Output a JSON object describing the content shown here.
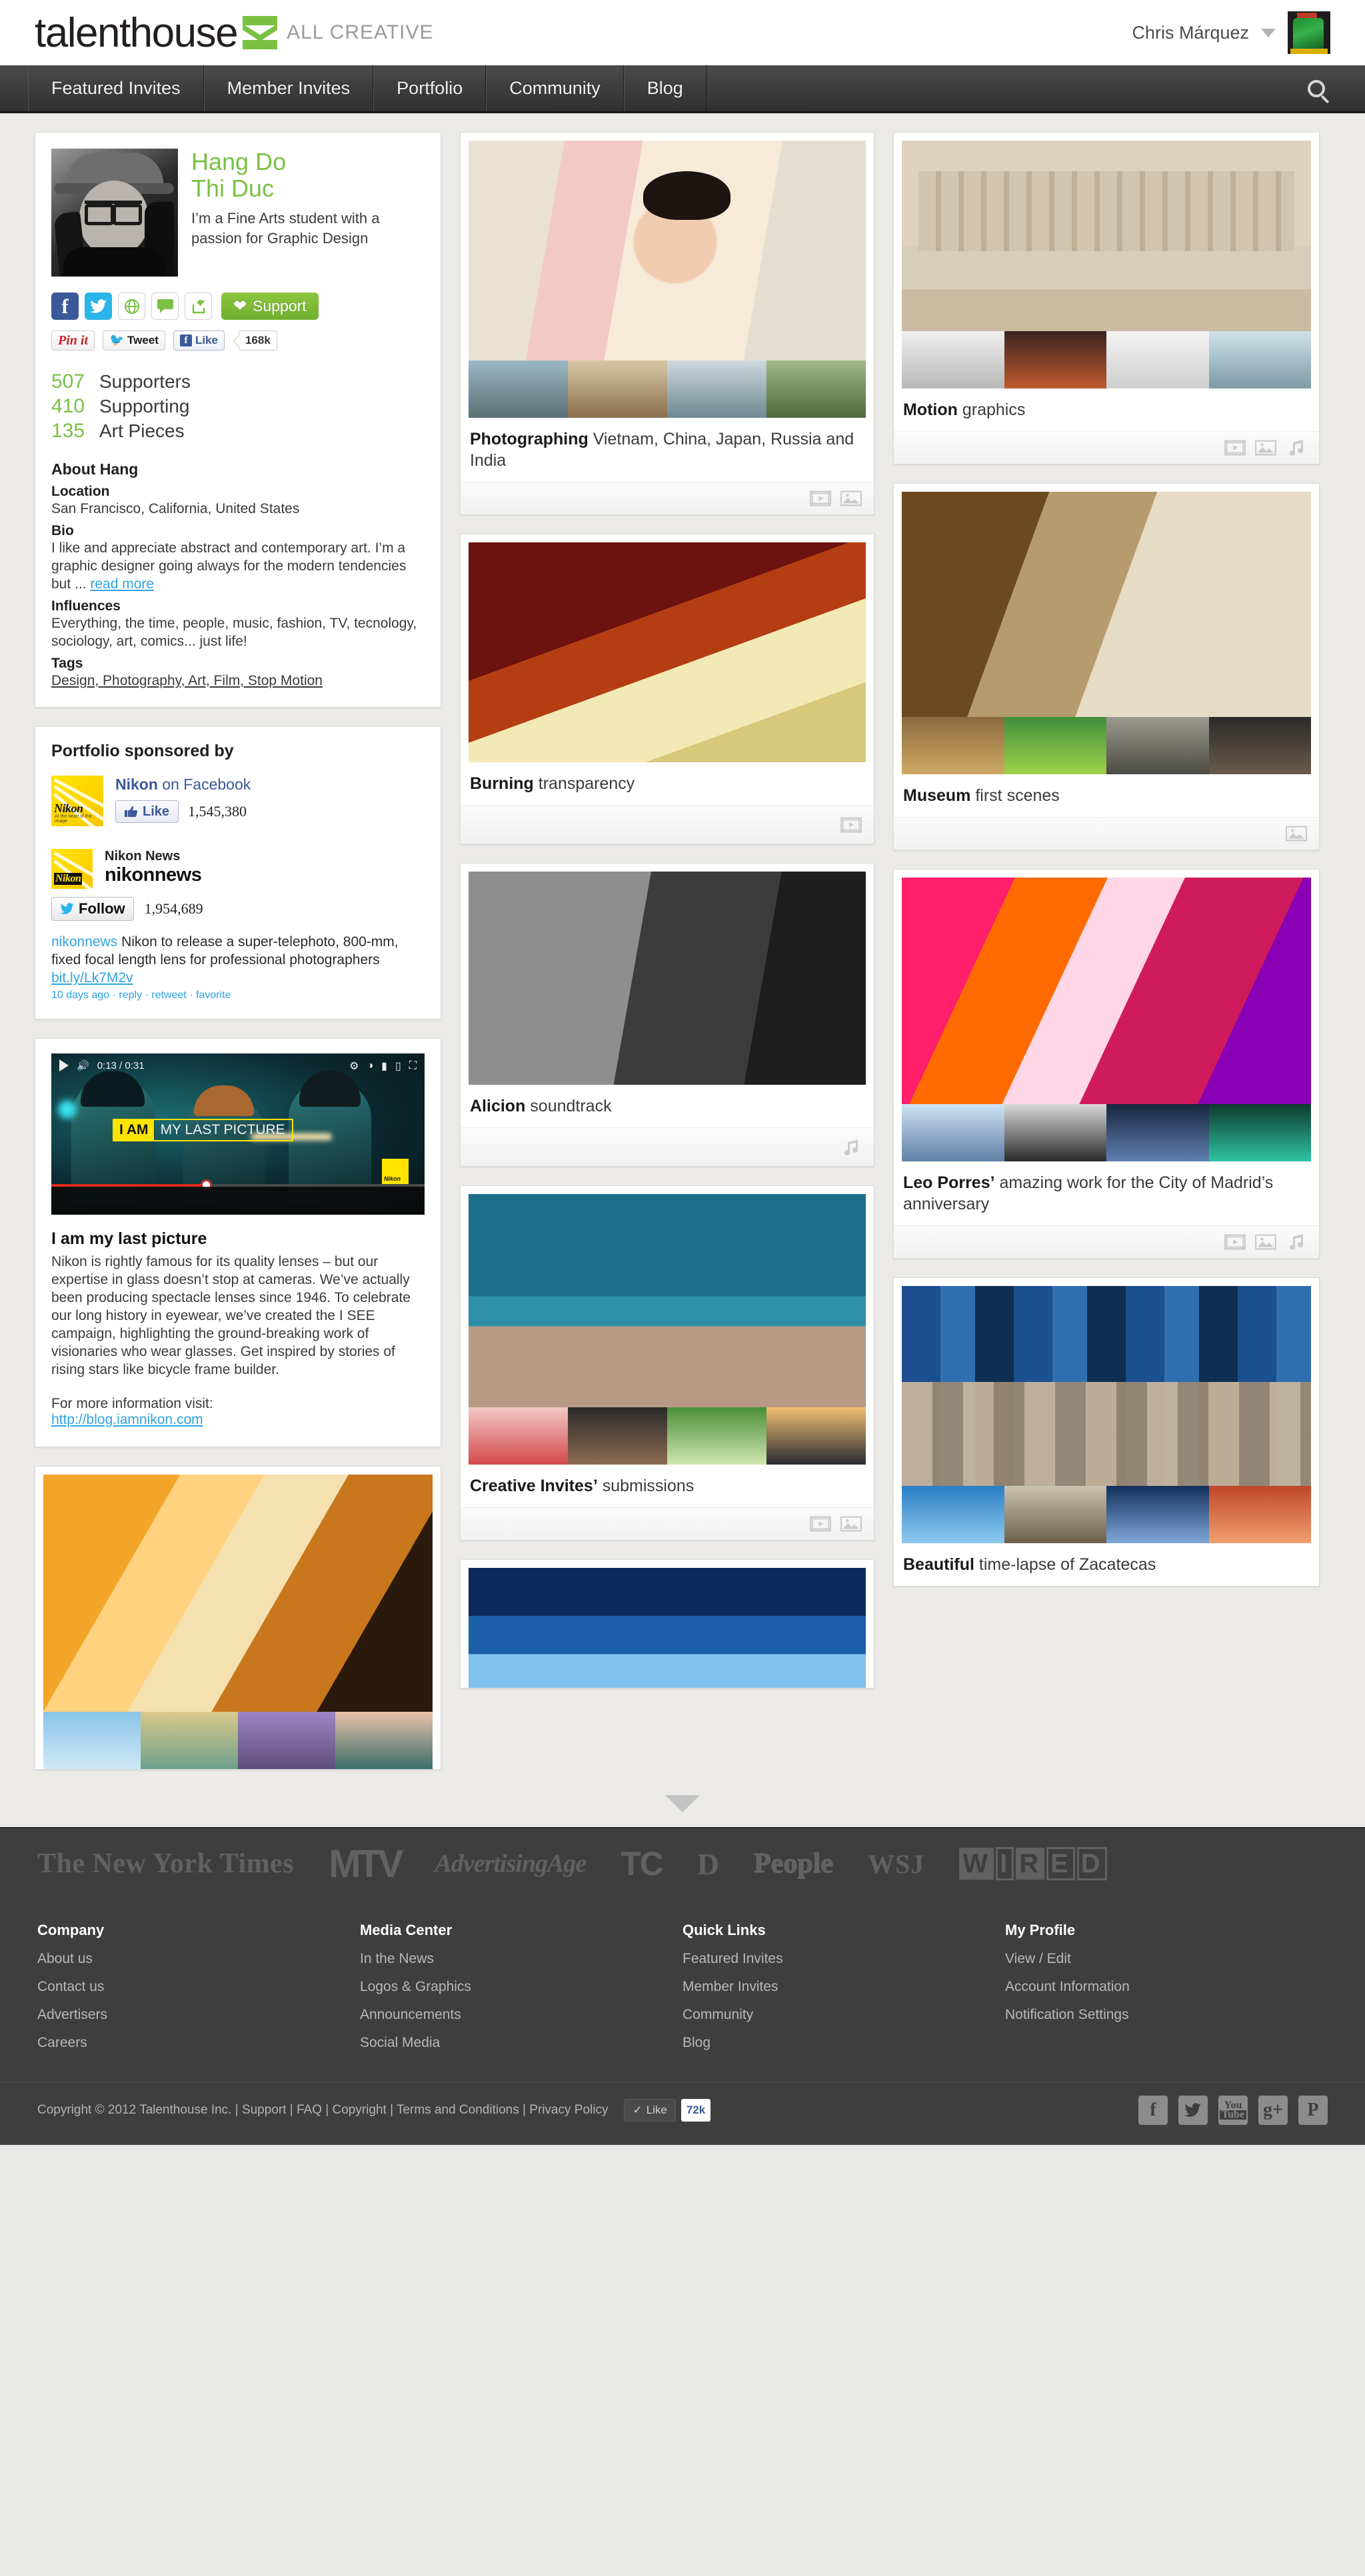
{
  "header": {
    "brand_word": "talenthouse",
    "brand_tagline": "ALL CREATIVE",
    "user_name": "Chris Márquez",
    "logo_icon": "talenthouse-chevron-logo",
    "caret_icon": "chevron-down-icon",
    "avatar_icon": "user-avatar"
  },
  "nav": {
    "items": [
      {
        "label": "Featured Invites"
      },
      {
        "label": "Member Invites"
      },
      {
        "label": "Portfolio"
      },
      {
        "label": "Community"
      },
      {
        "label": "Blog"
      }
    ],
    "search_icon": "search-icon"
  },
  "profile": {
    "name_line1": "Hang Do",
    "name_line2": "Thi Duc",
    "tagline": "I’m a Fine Arts student with a passion for Graphic Design",
    "social_icons": [
      "facebook-icon",
      "twitter-icon",
      "globe-icon",
      "comment-icon",
      "share-icon"
    ],
    "support_label": "Support",
    "support_icon": "heart-icon",
    "share_buttons": {
      "pinit_label": "Pin it",
      "tweet_label": "Tweet",
      "like_label": "Like",
      "like_count": "168k"
    },
    "stats": [
      {
        "value": "507",
        "label": "Supporters"
      },
      {
        "value": "410",
        "label": "Supporting"
      },
      {
        "value": "135",
        "label": "Art Pieces"
      }
    ],
    "about_heading": "About Hang",
    "location_label": "Location",
    "location_value": "San Francisco, California, United States",
    "bio_label": "Bio",
    "bio_value": "I like and appreciate abstract and contemporary art. I’m a graphic designer going always for the modern tendencies but ...",
    "read_more": "read more",
    "influences_label": "Influences",
    "influences_value": "Everything, the time, people, music, fashion, TV, tecnology, sociology, art, comics... just life!",
    "tags_label": "Tags",
    "tags_value": "Design, Photography, Art, Film, Stop Motion"
  },
  "sponsor": {
    "heading": "Portfolio sponsored by",
    "facebook": {
      "title_bold": "Nikon",
      "title_rest": " on Facebook",
      "like_label": "Like",
      "like_icon": "thumbs-up-icon",
      "count": "1,545,380"
    },
    "twitter": {
      "name": "Nikon News",
      "handle": "nikonnews",
      "follow_label": "Follow",
      "follow_icon": "twitter-bird-icon",
      "count": "1,954,689",
      "tweet_handle": "nikonnews",
      "tweet_text": " Nikon to release a super-telephoto, 800-mm, fixed focal length lens for professional photographers ",
      "tweet_link": "bit.ly/Lk7M2v",
      "tweet_meta": "10 days ago · reply · retweet · favorite"
    }
  },
  "sponsor_video": {
    "caption_highlight": "I AM",
    "caption_rest": "MY LAST PICTURE",
    "time": "0:13 / 0:31",
    "play_icon": "play-icon",
    "volume_icon": "volume-icon",
    "settings_icon": "gear-icon",
    "fullscreen_icon": "fullscreen-icon",
    "badge": "Nikon",
    "title": "I am my last picture",
    "body": "Nikon is rightly famous for its quality lenses – but our expertise in glass doesn’t stop at cameras. We’ve actually been producing spectacle lenses since 1946. To celebrate our long history in eyewear, we’ve created the I SEE campaign, highlighting the ground-breaking work of visionaries who wear glasses.  Get inspired by stories of rising stars like bicycle frame builder.",
    "more_info": "For more information visit:",
    "url": "http://blog.iamnikon.com"
  },
  "portfolio": {
    "middle_column": [
      {
        "title_bold": "Photographing",
        "title_rest": " Vietnam, China, Japan, Russia and India",
        "hero_class": "im-baby",
        "thumbs": [
          "t1",
          "t2",
          "t3",
          "t4"
        ],
        "icons": [
          "video-icon",
          "photo-icon"
        ]
      },
      {
        "title_bold": "Burning",
        "title_rest": " transparency",
        "hero_class": "im-burn",
        "thumbs": [],
        "icons": [
          "video-icon"
        ]
      },
      {
        "title_bold": "Alicion",
        "title_rest": " soundtrack",
        "hero_class": "im-alicia",
        "thumbs": [],
        "icons": [
          "music-icon"
        ]
      },
      {
        "title_bold": "Creative Invites’",
        "title_rest": " submissions",
        "hero_class": "im-water",
        "thumbs": [
          "t17",
          "t18",
          "t19",
          "t20"
        ],
        "icons": [
          "video-icon",
          "photo-icon"
        ]
      },
      {
        "title_bold": "",
        "title_rest": "",
        "hero_class": "im-blue",
        "thumbs": [],
        "icons": []
      }
    ],
    "right_column": [
      {
        "title_bold": "Motion",
        "title_rest": " graphics",
        "hero_class": "im-venice",
        "thumbs": [
          "t5",
          "t6",
          "t7",
          "t8"
        ],
        "icons": [
          "video-icon",
          "photo-icon",
          "music-icon"
        ]
      },
      {
        "title_bold": "Museum",
        "title_rest": " first scenes",
        "hero_class": "im-lion",
        "thumbs": [
          "t9",
          "t10",
          "t11",
          "t12"
        ],
        "icons": [
          "photo-icon"
        ]
      },
      {
        "title_bold": "Leo Porres’",
        "title_rest": " amazing work for the City of Madrid’s anniversary",
        "hero_class": "im-neon",
        "thumbs": [
          "t13",
          "t14",
          "t15",
          "t16"
        ],
        "icons": [
          "video-icon",
          "photo-icon",
          "music-icon"
        ]
      },
      {
        "title_bold": "Beautiful",
        "title_rest": " time-lapse of Zacatecas",
        "hero_class": "im-zac",
        "thumbs": [
          "t21",
          "t22",
          "t23",
          "t24"
        ],
        "icons": []
      }
    ],
    "left_column_extra": {
      "hero_class": "im-dance",
      "thumbs": [
        "t25",
        "t26",
        "t27",
        "t28"
      ]
    },
    "scroll_hint_icon": "chevron-down-icon"
  },
  "press_logos": [
    {
      "name": "The New York Times",
      "cls": "logo-nyt"
    },
    {
      "name": "MTV",
      "cls": "logo-mtv"
    },
    {
      "name": "AdvertisingAge",
      "cls": "logo-aa"
    },
    {
      "name": "TC",
      "cls": "logo-tc"
    },
    {
      "name": "D",
      "cls": "logo-d"
    },
    {
      "name": "People",
      "cls": "logo-people"
    },
    {
      "name": "WSJ",
      "cls": "logo-wsj"
    }
  ],
  "press_wired": "WIRED",
  "footer": {
    "columns": [
      {
        "heading": "Company",
        "links": [
          "About us",
          "Contact us",
          "Advertisers",
          "Careers"
        ]
      },
      {
        "heading": "Media Center",
        "links": [
          "In the News",
          "Logos & Graphics",
          "Announcements",
          "Social Media"
        ]
      },
      {
        "heading": "Quick Links",
        "links": [
          "Featured Invites",
          "Member Invites",
          "Community",
          "Blog"
        ]
      },
      {
        "heading": "My Profile",
        "links": [
          "View / Edit",
          "Account Information",
          "Notification Settings"
        ]
      }
    ],
    "copyright": "Copyright © 2012 Talenthouse Inc. | Support | FAQ | Copyright | Terms and Conditions | Privacy Policy",
    "like_label": "Like",
    "like_count": "72k",
    "social_icons": [
      "facebook-icon",
      "twitter-icon",
      "youtube-icon",
      "googleplus-icon",
      "pinterest-icon"
    ]
  }
}
